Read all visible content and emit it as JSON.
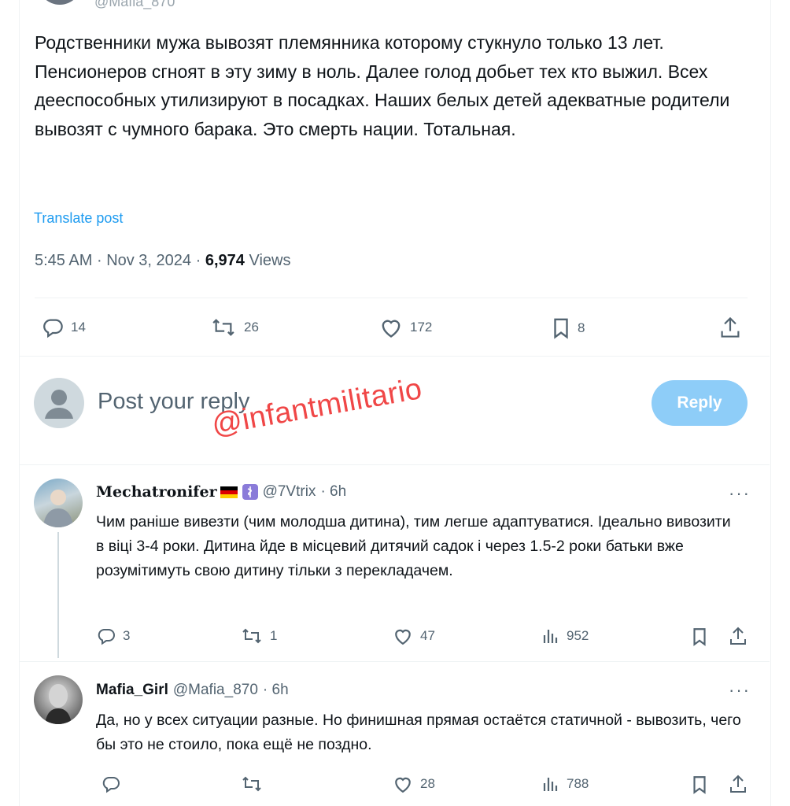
{
  "top_partial": {
    "handle": "@Mafia_870"
  },
  "post": {
    "paragraphs": [
      "Родственники мужа вывозят племянника которому стукнуло только 13 лет.",
      "Пенсионеров сгноят в эту зиму в ноль. Далее голод добьет тех кто выжил. Всех дееспособных утилизируют в посадках. Наших белых детей адекватные родители вывозят с чумного барака. Это смерть нации. Тотальная."
    ],
    "translate_label": "Translate post",
    "time": "5:45 AM",
    "date": "Nov 3, 2024",
    "separator": "·",
    "views_count": "6,974",
    "views_label": "Views",
    "actions": {
      "replies": "14",
      "reposts": "26",
      "likes": "172",
      "bookmarks": "8"
    }
  },
  "composer": {
    "placeholder": "Post your reply",
    "reply_label": "Reply"
  },
  "watermark": "@infantmilitario",
  "comments": [
    {
      "name": "Mechatronifer",
      "handle": "@7Vtrix",
      "time": "· 6h",
      "text": "Чим раніше вивезти (чим молодша дитина), тим легше адаптуватися. Ідеально вивозити в віці 3-4 роки. Дитина йде в місцевий дитячий садок і через 1.5-2 роки батьки вже розумітимуть свою дитину тільки з перекладачем.",
      "replies": "3",
      "reposts": "1",
      "likes": "47",
      "views": "952"
    },
    {
      "name": "Mafia_Girl",
      "handle": "@Mafia_870",
      "time": "· 6h",
      "text": "Да, но у всех ситуации разные. Но финишная прямая остаётся статичной - вывозить, чего бы это не стоило, пока ещё не поздно.",
      "replies": "",
      "reposts": "",
      "likes": "28",
      "views": "788"
    }
  ],
  "more_label": "···",
  "colors": {
    "accent": "#1d9bf0",
    "reply_button": "#8ecdf8",
    "watermark": "#f04747",
    "secondary_text": "#536471"
  },
  "icons": [
    "reply-icon",
    "repost-icon",
    "like-icon",
    "bookmark-icon",
    "share-icon",
    "views-icon",
    "default-avatar-icon",
    "more-icon"
  ]
}
